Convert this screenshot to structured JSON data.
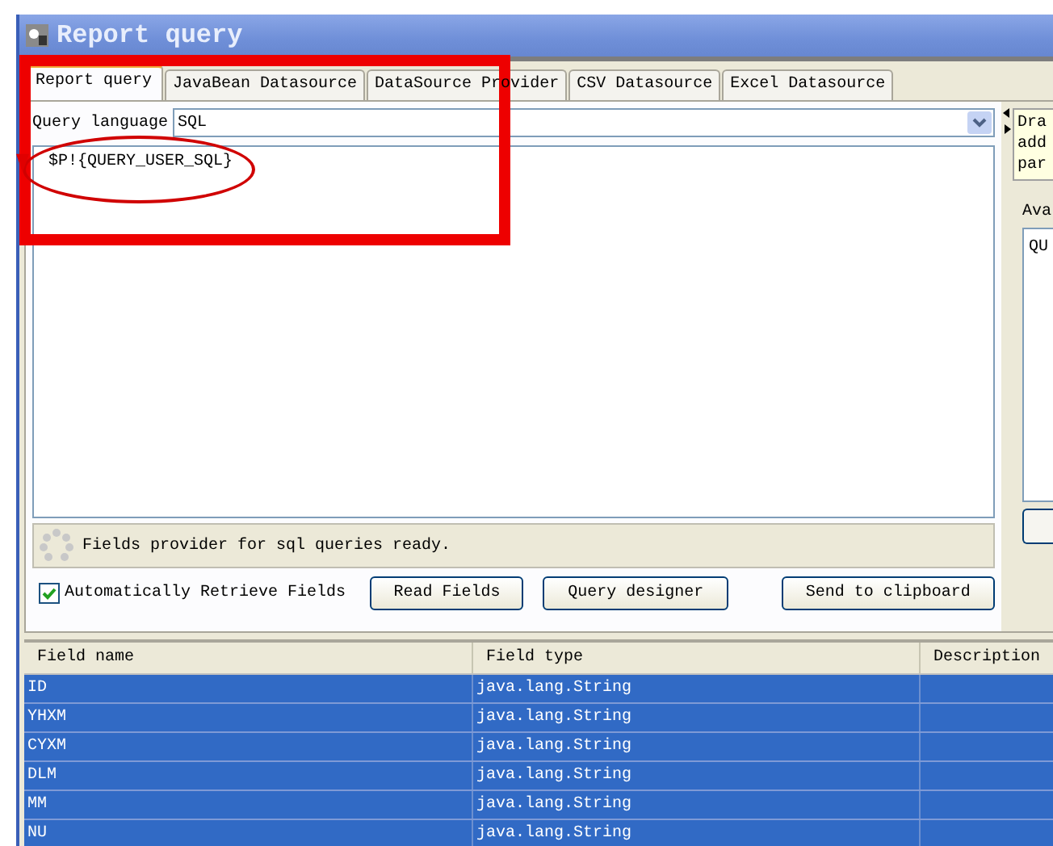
{
  "window": {
    "title": "Report query"
  },
  "tabs": [
    {
      "label": "Report query",
      "selected": true
    },
    {
      "label": "JavaBean Datasource",
      "selected": false
    },
    {
      "label": "DataSource Provider",
      "selected": false
    },
    {
      "label": "CSV Datasource",
      "selected": false
    },
    {
      "label": "Excel Datasource",
      "selected": false
    }
  ],
  "query_language": {
    "label": "Query language",
    "value": "SQL"
  },
  "query_text": "$P!{QUERY_USER_SQL}",
  "status": "Fields provider for sql queries ready.",
  "auto_retrieve": {
    "label": "Automatically Retrieve Fields",
    "checked": true
  },
  "buttons": [
    "Read Fields",
    "Query designer",
    "Send to clipboard"
  ],
  "side_panel": {
    "hint_lines": [
      "Dra",
      "add",
      "par"
    ],
    "label": "Ava",
    "items": [
      "QU"
    ]
  },
  "table": {
    "columns": [
      "Field name",
      "Field type",
      "Description"
    ],
    "rows": [
      {
        "cells": [
          "ID",
          "java.lang.String",
          ""
        ],
        "selected": true
      },
      {
        "cells": [
          "YHXM",
          "java.lang.String",
          ""
        ],
        "selected": true
      },
      {
        "cells": [
          "CYXM",
          "java.lang.String",
          ""
        ],
        "selected": true
      },
      {
        "cells": [
          "DLM",
          "java.lang.String",
          ""
        ],
        "selected": true
      },
      {
        "cells": [
          "MM",
          "java.lang.String",
          ""
        ],
        "selected": true
      },
      {
        "cells": [
          "NU",
          "java.lang.String",
          ""
        ],
        "selected": true
      }
    ]
  }
}
